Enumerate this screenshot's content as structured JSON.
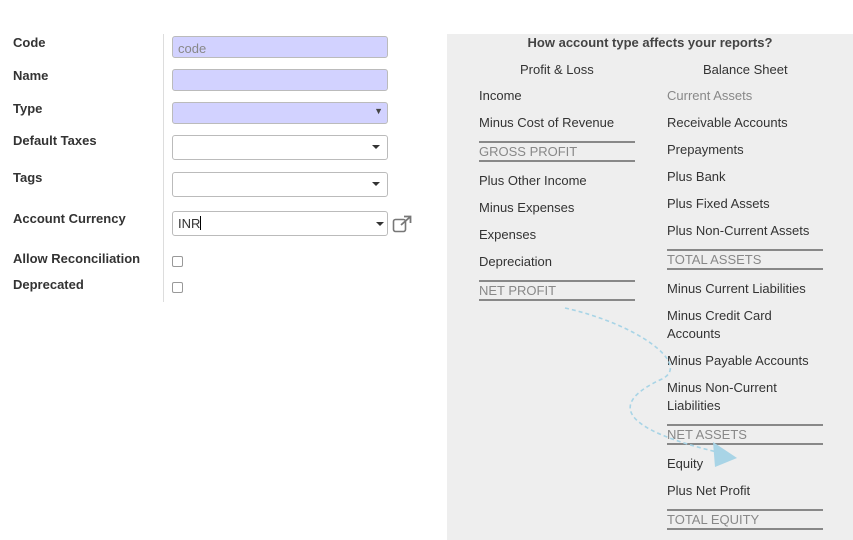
{
  "form": {
    "code_label": "Code",
    "code_placeholder": "code",
    "name_label": "Name",
    "type_label": "Type",
    "default_taxes_label": "Default Taxes",
    "tags_label": "Tags",
    "account_currency_label": "Account Currency",
    "account_currency_value": "INR",
    "allow_reconciliation_label": "Allow Reconciliation",
    "deprecated_label": "Deprecated"
  },
  "help": {
    "title": "How account type affects your reports?",
    "pl_header": "Profit & Loss",
    "bs_header": "Balance Sheet",
    "pl_items": [
      "Income",
      "Minus Cost of Revenue",
      "GROSS PROFIT",
      "Plus Other Income",
      "Minus Expenses",
      "Expenses",
      "Depreciation",
      "NET PROFIT"
    ],
    "bs_items": [
      "Current Assets",
      "Receivable Accounts",
      "Prepayments",
      "Plus Bank",
      "Plus Fixed Assets",
      "Plus Non-Current Assets",
      "TOTAL ASSETS",
      "Minus Current Liabilities",
      "Minus Credit Card Accounts",
      "Minus Payable Accounts",
      "Minus Non-Current Liabilities",
      "NET ASSETS",
      "Equity",
      "Plus Net Profit",
      "TOTAL EQUITY"
    ]
  },
  "colors": {
    "required_bg": "#d2d2ff",
    "panel_bg": "#eeeeee",
    "arrow": "#a8d4e6"
  }
}
